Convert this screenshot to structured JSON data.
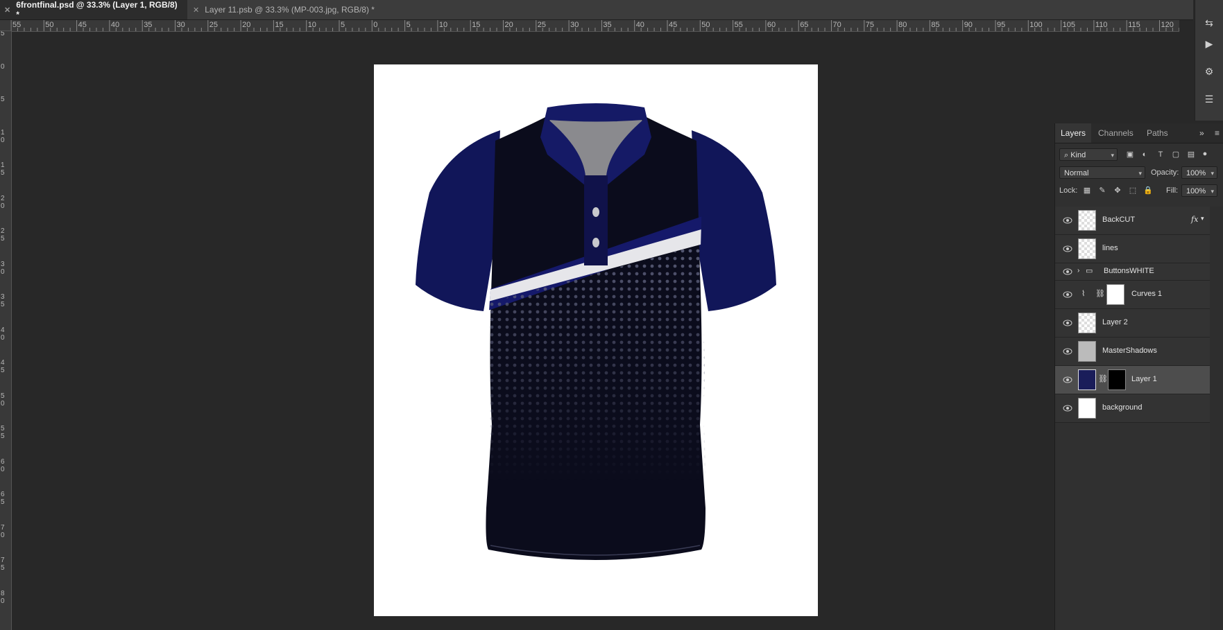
{
  "tabs": [
    {
      "label": "6frontfinal.psd @ 33.3% (Layer 1, RGB/8) *",
      "active": true
    },
    {
      "label": "Layer 11.psb @ 33.3% (MP-003.jpg, RGB/8) *",
      "active": false
    }
  ],
  "ruler": {
    "horizontal": [
      "55",
      "50",
      "45",
      "40",
      "35",
      "30",
      "25",
      "20",
      "15",
      "10",
      "5",
      "0",
      "5",
      "10",
      "15",
      "20",
      "25",
      "30",
      "35",
      "40",
      "45",
      "50",
      "55",
      "60",
      "65",
      "70",
      "75",
      "80",
      "85",
      "90",
      "95",
      "100",
      "105",
      "110",
      "115",
      "120"
    ],
    "vertical": [
      "5",
      "0",
      "5",
      "1 0",
      "1 5",
      "2 0",
      "2 5",
      "3 0",
      "3 5",
      "4 0",
      "4 5",
      "5 0",
      "5 5",
      "6 0",
      "6 5",
      "7 0",
      "7 5",
      "8 0"
    ]
  },
  "layers_panel": {
    "tabs": [
      "Layers",
      "Channels",
      "Paths"
    ],
    "filter_kind": "Kind",
    "blend_mode": "Normal",
    "opacity_label": "Opacity:",
    "opacity_value": "100%",
    "lock_label": "Lock:",
    "fill_label": "Fill:",
    "fill_value": "100%",
    "fx_label": "fx",
    "layers": [
      {
        "name": "BackCUT",
        "type": "pixel",
        "fx": true
      },
      {
        "name": "lines",
        "type": "smart"
      },
      {
        "name": "ButtonsWHITE",
        "type": "group"
      },
      {
        "name": "Curves 1",
        "type": "adjustment"
      },
      {
        "name": "Layer 2",
        "type": "pixel"
      },
      {
        "name": "MasterShadows",
        "type": "pixel"
      },
      {
        "name": "Layer 1",
        "type": "smart-masked",
        "selected": true
      },
      {
        "name": "background",
        "type": "fill"
      }
    ]
  },
  "colors": {
    "accent_navy": "#11175c",
    "shirt_body": "#0b0c1c",
    "stripe_white": "#e6e6ea"
  }
}
